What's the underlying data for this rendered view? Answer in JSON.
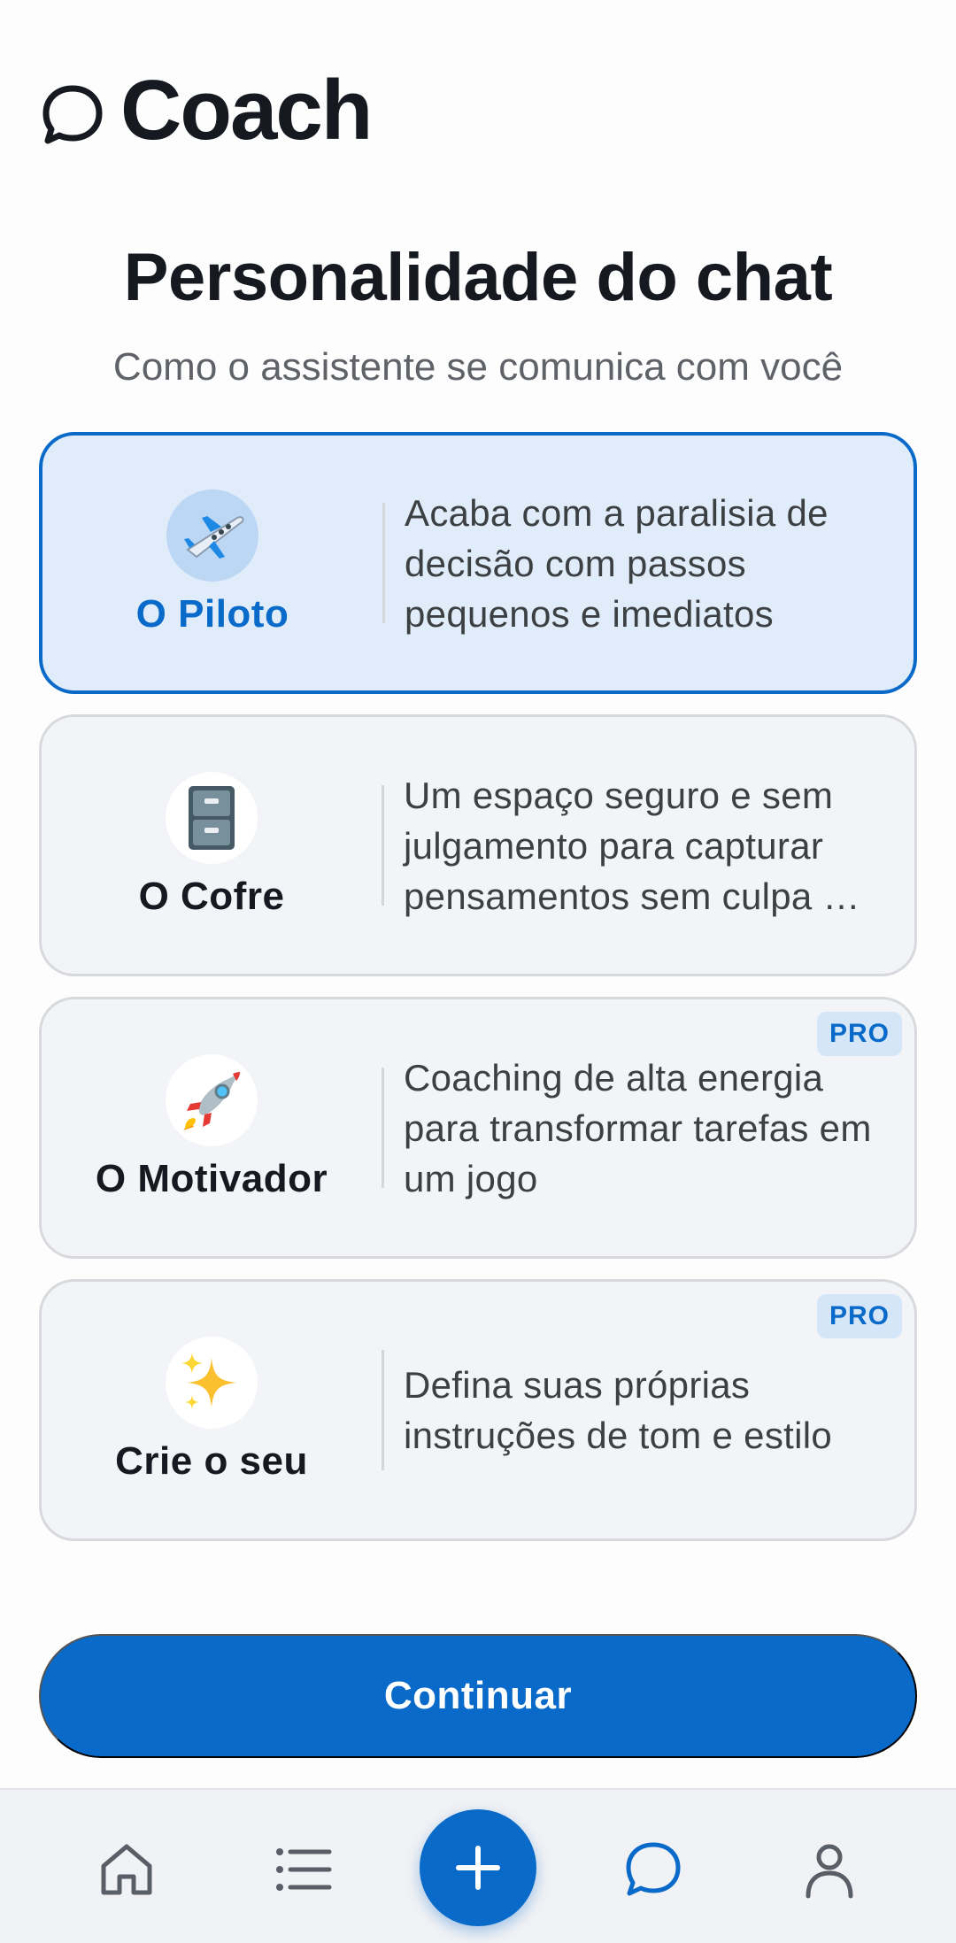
{
  "header": {
    "title": "Coach",
    "logo_icon": "chat-bubble-icon"
  },
  "page": {
    "title": "Personalidade do chat",
    "subtitle": "Como o assistente se comunica com você"
  },
  "personalities": [
    {
      "name": "O Piloto",
      "icon": "airplane-icon",
      "description": "Acaba com a paralisia de decisão com passos pequenos e imediatos",
      "selected": true,
      "badge": ""
    },
    {
      "name": "O Cofre",
      "icon": "file-cabinet-icon",
      "description": "Um espaço seguro e sem julgamento para capturar pensamentos sem culpa …",
      "selected": false,
      "badge": ""
    },
    {
      "name": "O Motivador",
      "icon": "rocket-icon",
      "description": "Coaching de alta energia para transformar tarefas em um jogo",
      "selected": false,
      "badge": "PRO"
    },
    {
      "name": "Crie o seu",
      "icon": "sparkles-icon",
      "description": "Defina suas próprias instruções de tom e estilo",
      "selected": false,
      "badge": "PRO"
    }
  ],
  "continue_label": "Continuar",
  "bottom_nav": {
    "items": [
      "home-icon",
      "list-icon",
      "add-icon",
      "chat-icon",
      "profile-icon"
    ],
    "active": "chat-icon"
  },
  "colors": {
    "accent": "#0a6ac9",
    "selected_card_bg": "#e0ecf9",
    "card_bg": "#f3f4f7",
    "badge_bg": "#d5e6f8"
  }
}
